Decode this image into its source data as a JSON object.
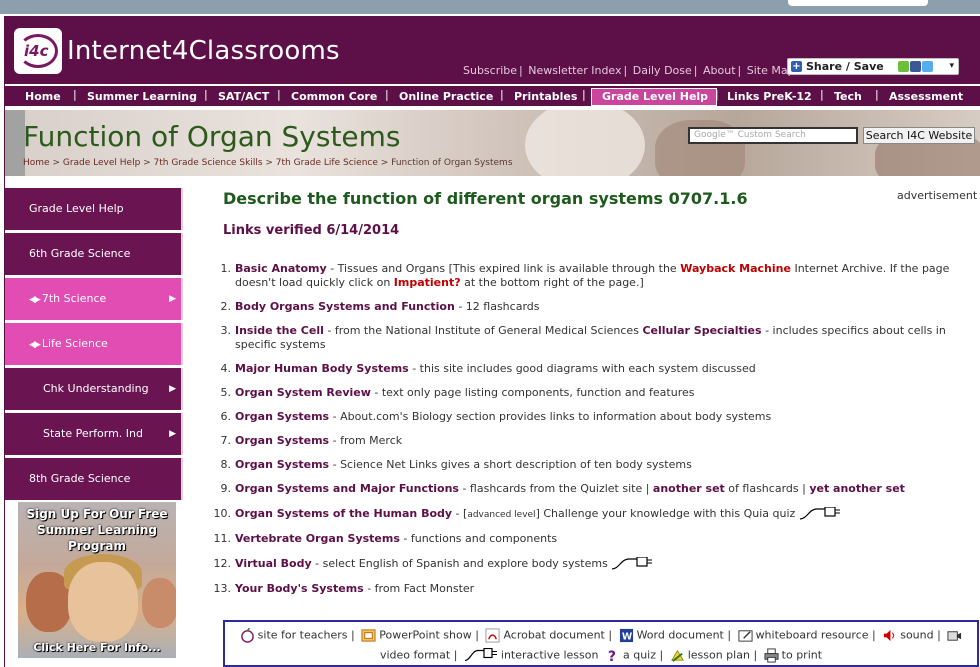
{
  "site": {
    "logo_mark": "i4c",
    "logo_text": "Internet4Classrooms"
  },
  "top_links": [
    "Subscribe",
    "Newsletter Index",
    "Daily Dose",
    "About",
    "Site Map"
  ],
  "share": {
    "label": "Share / Save"
  },
  "nav": {
    "items": [
      "Home",
      "Summer Learning",
      "SAT/ACT",
      "Common Core",
      "Online Practice",
      "Printables",
      "Grade Level Help",
      "Links PreK-12",
      "Tech",
      "Assessment"
    ],
    "active": "Grade Level Help"
  },
  "banner": {
    "title": "Function of Organ Systems",
    "breadcrumb": [
      "Home",
      "Grade Level Help",
      "7th Grade Science Skills",
      "7th Grade Life Science",
      "Function of Organ Systems"
    ],
    "search_placeholder": "Google™ Custom Search",
    "search_button": "Search I4C Website"
  },
  "sidebar": {
    "items": [
      {
        "label": "Grade Level Help"
      },
      {
        "label": "6th Grade Science"
      },
      {
        "label": "7th Science"
      },
      {
        "label": "Life Science"
      },
      {
        "label": "Chk Understanding"
      },
      {
        "label": "State Perform. Ind"
      },
      {
        "label": "8th Grade Science"
      }
    ],
    "promo": {
      "headline": "Sign Up For Our Free Summer Learning Program",
      "cta": "Click Here For Info..."
    }
  },
  "content": {
    "heading": "Describe the function of different organ systems 0707.1.6",
    "verified": "Links verified 6/14/2014",
    "advertisement": "advertisement",
    "items": [
      {
        "num": "1.",
        "link": "Basic Anatomy",
        "text_a": " - Tissues and Organs [This expired link is available through the ",
        "link2": "Wayback Machine",
        "text_b": " Internet Archive. If the page doesn't load quickly click on ",
        "link3": "Impatient?",
        "text_c": " at the bottom right of the page.]"
      },
      {
        "num": "2.",
        "link": "Body Organs Systems and Function",
        "text_a": " - 12 flashcards"
      },
      {
        "num": "3.",
        "link": "Inside the Cell",
        "text_a": " - from the National Institute of General Medical Sciences ",
        "link2": "Cellular Specialties",
        "text_b": " - includes specifics about cells in specific systems"
      },
      {
        "num": "4.",
        "link": "Major Human Body Systems",
        "text_a": " - this site includes good diagrams with each system discussed"
      },
      {
        "num": "5.",
        "link": "Organ System Review",
        "text_a": " - text only page listing components, function and features"
      },
      {
        "num": "6.",
        "link": "Organ Systems",
        "text_a": " - About.com's Biology section provides links to information about body systems"
      },
      {
        "num": "7.",
        "link": "Organ Systems",
        "text_a": " - from Merck"
      },
      {
        "num": "8.",
        "link": "Organ Systems",
        "text_a": " - Science Net Links gives a short description of ten body systems"
      },
      {
        "num": "9.",
        "link": "Organ Systems and Major Functions",
        "text_a": " - flashcards from the Quizlet site | ",
        "link2": "another set",
        "text_b": " of flashcards | ",
        "link3": "yet another set"
      },
      {
        "num": "10.",
        "link": "Organ Systems of the Human Body",
        "text_a": " - [",
        "small": "advanced level",
        "text_b": "] Challenge your knowledge with this Quia quiz"
      },
      {
        "num": "11.",
        "link": "Vertebrate Organ Systems",
        "text_a": " - functions and components"
      },
      {
        "num": "12.",
        "link": "Virtual Body",
        "text_a": " - select English of Spanish and explore body systems"
      },
      {
        "num": "13.",
        "link": "Your Body's Systems",
        "text_a": " - from Fact Monster"
      }
    ]
  },
  "legend": {
    "row1": [
      "site for teachers",
      "PowerPoint show",
      "Acrobat document",
      "Word document",
      "whiteboard resource",
      "sound"
    ],
    "row2": [
      "video format",
      "interactive lesson",
      "a quiz",
      "lesson plan",
      "to print"
    ]
  },
  "colors": {
    "brand": "#5d0f47",
    "accent_pink": "#e14db2",
    "heading_green": "#1e5a1e",
    "legend_border": "#2b2b9e"
  }
}
